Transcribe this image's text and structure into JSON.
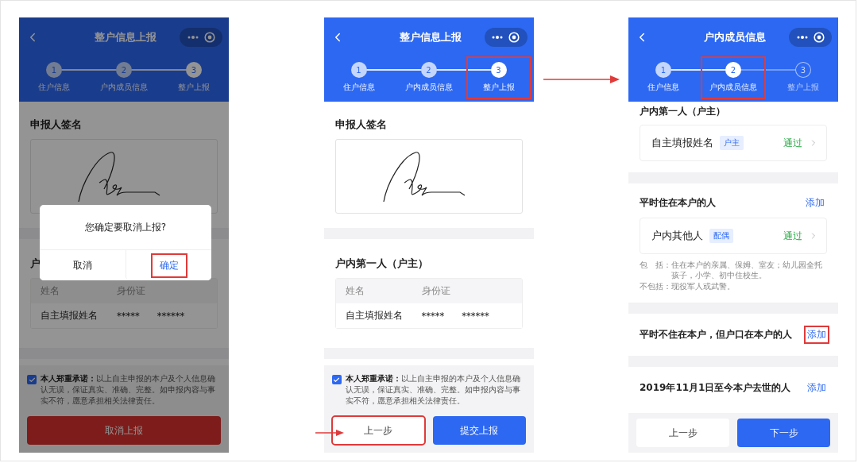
{
  "screens": [
    {
      "title": "整户信息上报",
      "dimmed": true,
      "steps": [
        {
          "number": "1",
          "label": "住户信息",
          "current": false,
          "reached": true,
          "highlighted": false
        },
        {
          "number": "2",
          "label": "户内成员信息",
          "current": false,
          "reached": true,
          "highlighted": false
        },
        {
          "number": "3",
          "label": "整户上报",
          "current": true,
          "reached": true,
          "highlighted": false
        }
      ],
      "sections": [
        {
          "kind": "signature",
          "title": "申报人签名"
        },
        {
          "kind": "divider"
        },
        {
          "kind": "person_table",
          "title": "户",
          "columns": [
            "姓名",
            "身份证"
          ],
          "rows": [
            {
              "name": "自主填报姓名",
              "id": "*****      ******"
            }
          ]
        },
        {
          "kind": "divider"
        }
      ],
      "footer": {
        "promise": {
          "checked": true,
          "text": "**本人郑重承诺：**以上自主申报的本户及个人信息确认无误，保证真实、准确、完整。如申报内容与事实不符，愿意承担相关法律责任。"
        },
        "buttons": [
          {
            "label": "取消上报",
            "kind": "danger",
            "highlighted": false
          }
        ]
      },
      "dialog": {
        "message": "您确定要取消上报?",
        "buttons": [
          {
            "label": "取消",
            "kind": "cancel",
            "highlighted": false
          },
          {
            "label": "确定",
            "kind": "confirm",
            "highlighted": true
          }
        ]
      }
    },
    {
      "title": "整户信息上报",
      "dimmed": false,
      "steps": [
        {
          "number": "1",
          "label": "住户信息",
          "current": false,
          "reached": true,
          "highlighted": false
        },
        {
          "number": "2",
          "label": "户内成员信息",
          "current": false,
          "reached": true,
          "highlighted": false
        },
        {
          "number": "3",
          "label": "整户上报",
          "current": true,
          "reached": true,
          "highlighted": true
        }
      ],
      "sections": [
        {
          "kind": "signature",
          "title": "申报人签名"
        },
        {
          "kind": "divider"
        },
        {
          "kind": "person_table",
          "title": "户内第一人（户主）",
          "columns": [
            "姓名",
            "身份证"
          ],
          "rows": [
            {
              "name": "自主填报姓名",
              "id": "*****      ******"
            }
          ]
        },
        {
          "kind": "divider"
        }
      ],
      "footer": {
        "promise": {
          "checked": true,
          "text": "**本人郑重承诺：**以上自主申报的本户及个人信息确认无误，保证真实、准确、完整。如申报内容与事实不符，愿意承担相关法律责任。"
        },
        "buttons": [
          {
            "label": "上一步",
            "kind": "secondary",
            "highlighted": true
          },
          {
            "label": "提交上报",
            "kind": "primary",
            "highlighted": false
          }
        ]
      }
    },
    {
      "title": "户内成员信息",
      "dimmed": false,
      "steps": [
        {
          "number": "1",
          "label": "住户信息",
          "current": false,
          "reached": true,
          "highlighted": false
        },
        {
          "number": "2",
          "label": "户内成员信息",
          "current": true,
          "reached": true,
          "highlighted": true
        },
        {
          "number": "3",
          "label": "整户上报",
          "current": false,
          "reached": false,
          "highlighted": false
        }
      ],
      "sections": [
        {
          "kind": "member_group",
          "title": "户内第一人（户主）",
          "members": [
            {
              "name": "自主填报姓名",
              "tag": "户主",
              "status": "通过"
            }
          ]
        },
        {
          "kind": "divider"
        },
        {
          "kind": "member_group",
          "title": "平时住在本户的人",
          "add": {
            "label": "添加",
            "highlighted": false
          },
          "members": [
            {
              "name": "户内其他人",
              "tag": "配偶",
              "status": "通过"
            }
          ],
          "notes": [
            {
              "label": "包　括：",
              "text": "住在本户的亲属、保姆、室友；幼儿园全托孩子，小学、初中住校生。"
            },
            {
              "label": "不包括：",
              "text": "现役军人或武警。"
            }
          ]
        },
        {
          "kind": "divider"
        },
        {
          "kind": "member_group",
          "title": "平时不住在本户，但户口在本户的人",
          "add": {
            "label": "添加",
            "highlighted": true
          }
        },
        {
          "kind": "divider"
        },
        {
          "kind": "member_group",
          "title": "2019年11月1日至今本户去世的人",
          "add": {
            "label": "添加",
            "highlighted": false
          }
        }
      ],
      "footer": {
        "buttons": [
          {
            "label": "上一步",
            "kind": "secondary",
            "highlighted": false
          },
          {
            "label": "下一步",
            "kind": "primary",
            "highlighted": false
          }
        ]
      }
    }
  ]
}
